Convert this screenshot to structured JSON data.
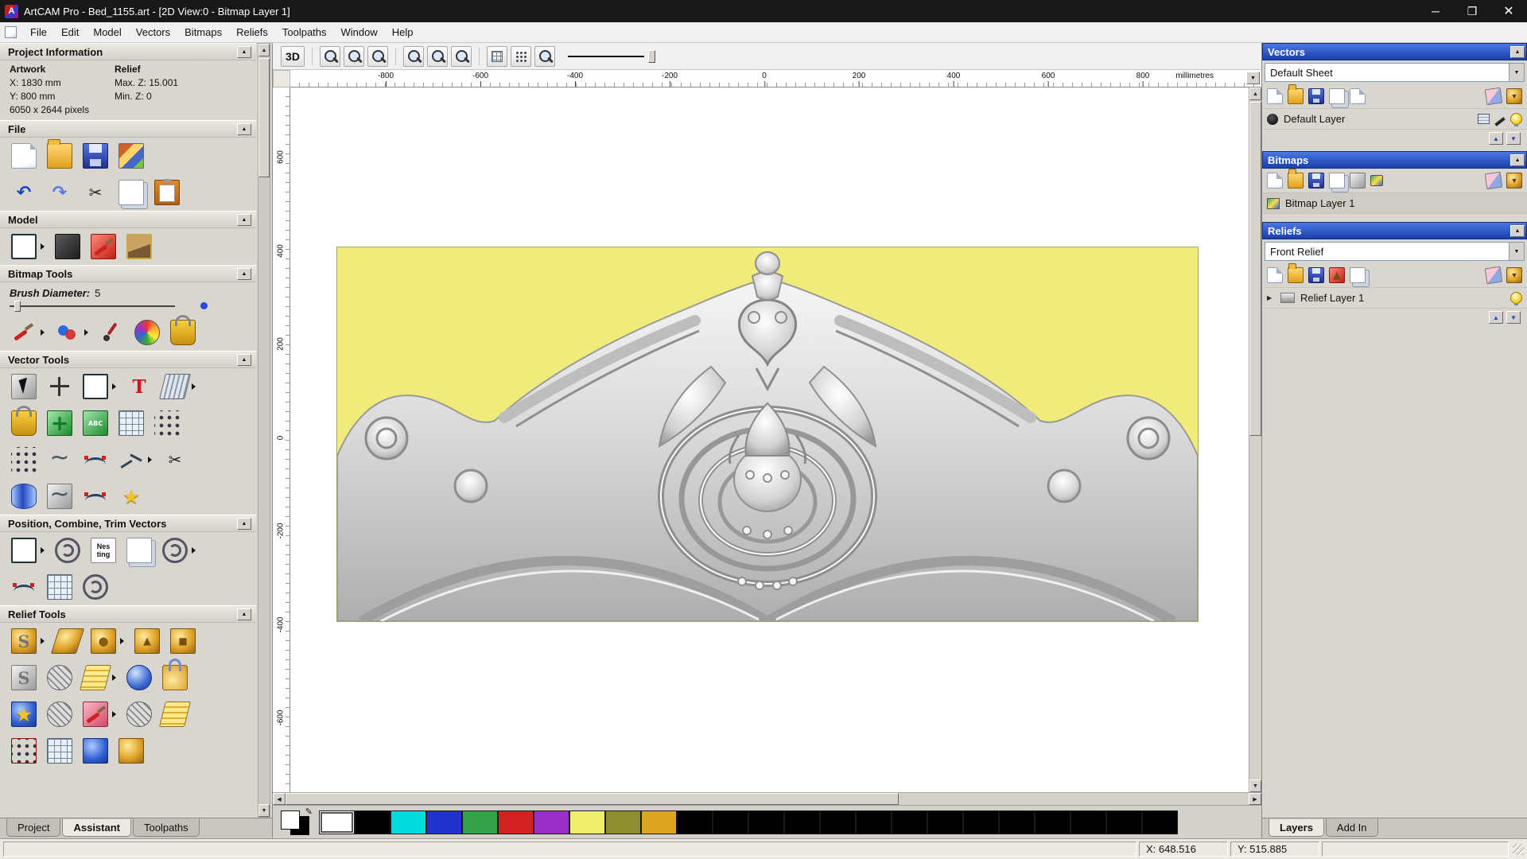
{
  "window": {
    "title": "ArtCAM Pro - Bed_1155.art - [2D View:0 - Bitmap Layer 1]"
  },
  "menu": {
    "items": [
      "File",
      "Edit",
      "Model",
      "Vectors",
      "Bitmaps",
      "Reliefs",
      "Toolpaths",
      "Window",
      "Help"
    ]
  },
  "left_panel": {
    "project_info": {
      "title": "Project Information",
      "artwork_label": "Artwork",
      "relief_label": "Relief",
      "x": "X: 1830 mm",
      "y": "Y: 800 mm",
      "pixels": "6050 x 2644 pixels",
      "max_z": "Max. Z: 15.001",
      "min_z": "Min. Z: 0"
    },
    "sections": {
      "file": "File",
      "model": "Model",
      "bitmap": "Bitmap Tools",
      "vector": "Vector Tools",
      "position": "Position, Combine, Trim Vectors",
      "relief": "Relief Tools"
    },
    "brush": {
      "label": "Brush Diameter:",
      "value": "5"
    },
    "nesting_label": "Nes ting",
    "tabs": [
      "Project",
      "Assistant",
      "Toolpaths"
    ]
  },
  "toolbar": {
    "view3d": "3D"
  },
  "ruler": {
    "units": "millimetres",
    "h_ticks": [
      "-800",
      "-600",
      "-400",
      "-200",
      "0",
      "200",
      "400",
      "600",
      "800"
    ],
    "v_ticks": [
      "600",
      "400",
      "200",
      "0",
      "-200",
      "-400",
      "-600"
    ]
  },
  "canvas": {
    "bg": "#f0ec7c"
  },
  "right_panel": {
    "vectors": {
      "title": "Vectors",
      "sheet": "Default Sheet",
      "layer": "Default Layer"
    },
    "bitmaps": {
      "title": "Bitmaps",
      "layer": "Bitmap Layer 1"
    },
    "reliefs": {
      "title": "Reliefs",
      "selected": "Front Relief",
      "layer": "Relief Layer 1"
    },
    "tabs": [
      "Layers",
      "Add In"
    ]
  },
  "status": {
    "x": "X: 648.516",
    "y": "Y: 515.885"
  },
  "palette": {
    "colors": [
      "#ffffff",
      "#000000",
      "#00dcdc",
      "#2233cc",
      "#33a04a",
      "#d42222",
      "#9a30c8",
      "#f0ee6a",
      "#8e8e30",
      "#daa520",
      "#000000",
      "#000000",
      "#000000",
      "#000000",
      "#000000",
      "#000000",
      "#000000",
      "#000000",
      "#000000",
      "#000000",
      "#000000",
      "#000000",
      "#000000",
      "#000000"
    ]
  }
}
